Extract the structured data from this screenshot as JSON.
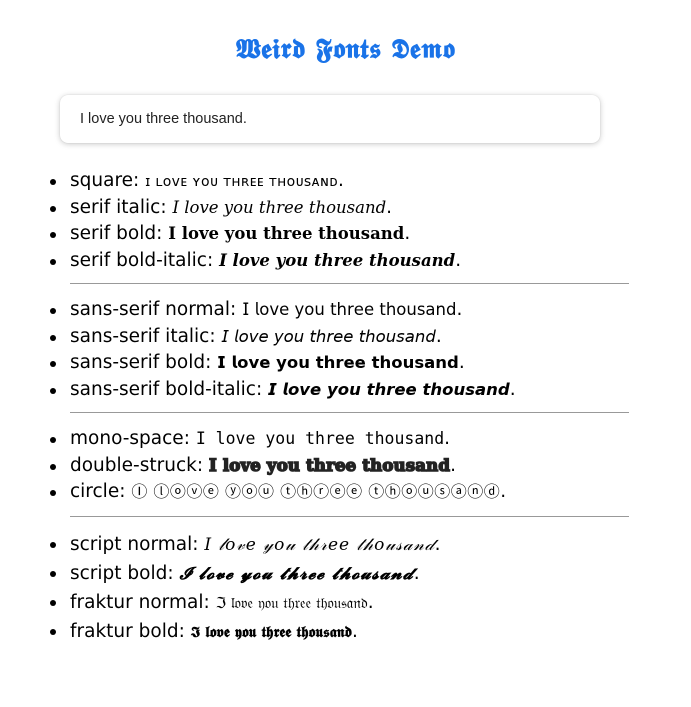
{
  "title": "𝖂𝖊𝖎𝖗𝖉 𝕱𝖔𝖓𝖙𝖘 𝕯𝖊𝖒𝖔",
  "input": {
    "value": "I love you three thousand."
  },
  "groups": [
    {
      "items": [
        {
          "label": "square",
          "value": "ɪ ʟᴏᴠᴇ ʏᴏᴜ ᴛʜʀᴇᴇ ᴛʜᴏᴜsᴀɴᴅ",
          "style": "f-sc"
        },
        {
          "label": "serif italic",
          "value": "𝐼 𝑙𝑜𝑣𝑒 𝑦𝑜𝑢 𝑡ℎ𝑟𝑒𝑒 𝑡ℎ𝑜𝑢𝑠𝑎𝑛𝑑",
          "style": "f-si"
        },
        {
          "label": "serif bold",
          "value": "𝐈 𝐥𝐨𝐯𝐞 𝐲𝐨𝐮 𝐭𝐡𝐫𝐞𝐞 𝐭𝐡𝐨𝐮𝐬𝐚𝐧𝐝",
          "style": "f-sb"
        },
        {
          "label": "serif bold-italic",
          "value": "𝑰 𝒍𝒐𝒗𝒆 𝒚𝒐𝒖 𝒕𝒉𝒓𝒆𝒆 𝒕𝒉𝒐𝒖𝒔𝒂𝒏𝒅",
          "style": "f-sbi"
        }
      ]
    },
    {
      "items": [
        {
          "label": "sans-serif normal",
          "value": "𝖨 𝗅𝗈𝗏𝖾 𝗒𝗈𝗎 𝗍𝗁𝗋𝖾𝖾 𝗍𝗁𝗈𝗎𝗌𝖺𝗇𝖽",
          "style": "f-ssn"
        },
        {
          "label": "sans-serif italic",
          "value": "𝘐 𝘭𝘰𝘷𝘦 𝘺𝘰𝘶 𝘵𝘩𝘳𝘦𝘦 𝘵𝘩𝘰𝘶𝘴𝘢𝘯𝘥",
          "style": "f-ssi"
        },
        {
          "label": "sans-serif bold",
          "value": "𝗜 𝗹𝗼𝘃𝗲 𝘆𝗼𝘂 𝘁𝗵𝗿𝗲𝗲 𝘁𝗵𝗼𝘂𝘀𝗮𝗻𝗱",
          "style": "f-ssb"
        },
        {
          "label": "sans-serif bold-italic",
          "value": "𝙄 𝙡𝙤𝙫𝙚 𝙮𝙤𝙪 𝙩𝙝𝙧𝙚𝙚 𝙩𝙝𝙤𝙪𝙨𝙖𝙣𝙙",
          "style": "f-ssbi"
        }
      ]
    },
    {
      "items": [
        {
          "label": "mono-space",
          "value": "𝙸 𝚕𝚘𝚟𝚎 𝚢𝚘𝚞 𝚝𝚑𝚛𝚎𝚎 𝚝𝚑𝚘𝚞𝚜𝚊𝚗𝚍",
          "style": "f-mono"
        },
        {
          "label": "double-struck",
          "value": "𝕀 𝕝𝕠𝕧𝕖 𝕪𝕠𝕦 𝕥𝕙𝕣𝕖𝕖 𝕥𝕙𝕠𝕦𝕤𝕒𝕟𝕕",
          "style": "f-ds"
        },
        {
          "label": "circle",
          "value": "Ⓘ ⓛⓞⓥⓔ ⓨⓞⓤ ⓣⓗⓡⓔⓔ ⓣⓗⓞⓤⓢⓐⓝⓓ",
          "style": "f-circ"
        }
      ]
    },
    {
      "items": [
        {
          "label": "script normal",
          "value": "𝐼 𝓁𝑜𝓋𝑒 𝓎𝑜𝓊 𝓉𝒽𝓇𝑒𝑒 𝓉𝒽𝑜𝓊𝓈𝒶𝓃𝒹",
          "style": "f-scr"
        },
        {
          "label": "script bold",
          "value": "𝓘 𝓵𝓸𝓿𝓮 𝔂𝓸𝓾 𝓽𝓱𝓻𝓮𝓮 𝓽𝓱𝓸𝓾𝓼𝓪𝓷𝓭",
          "style": "f-scrb"
        },
        {
          "label": "fraktur normal",
          "value": "ℑ 𝔩𝔬𝔳𝔢 𝔶𝔬𝔲 𝔱𝔥𝔯𝔢𝔢 𝔱𝔥𝔬𝔲𝔰𝔞𝔫𝔡",
          "style": "f-frak"
        },
        {
          "label": "fraktur bold",
          "value": "𝕴 𝖑𝖔𝖛𝖊 𝖞𝖔𝖚 𝖙𝖍𝖗𝖊𝖊 𝖙𝖍𝖔𝖚𝖘𝖆𝖓𝖉",
          "style": "f-frakb"
        }
      ]
    }
  ],
  "separator": ": ",
  "terminator": ".",
  "colors": {
    "title": "#1a73e8",
    "rule": "#999999"
  }
}
